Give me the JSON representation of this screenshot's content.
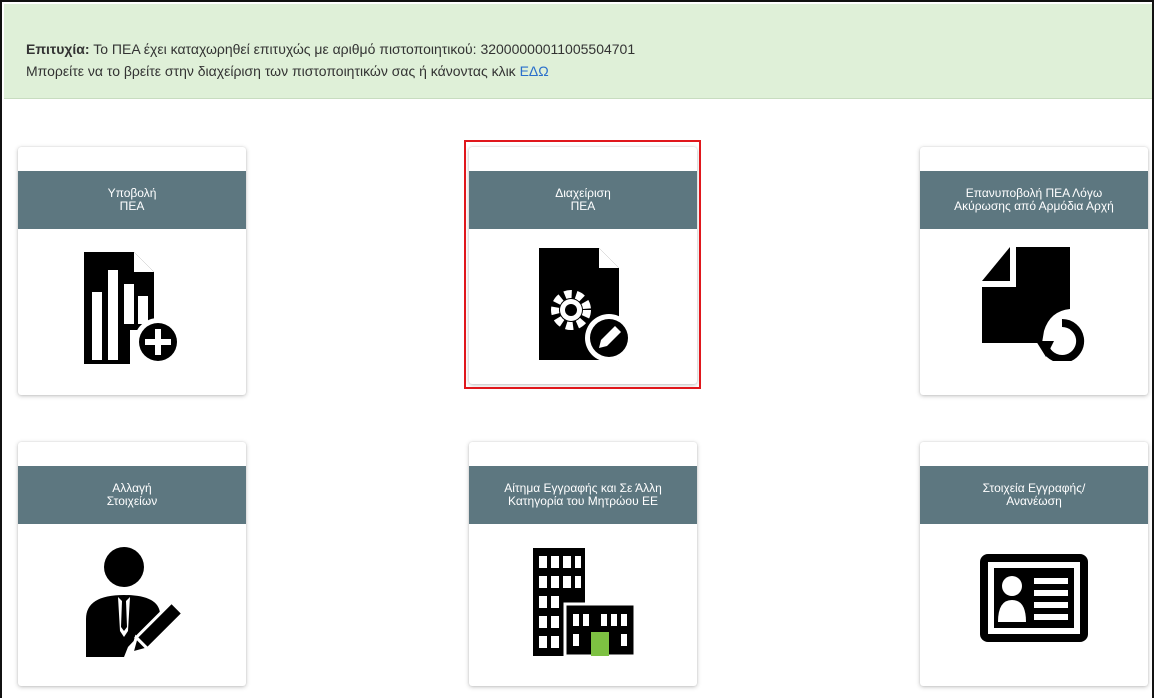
{
  "alert": {
    "label": "Επιτυχία:",
    "message": " Το ΠΕΑ έχει καταχωρηθεί επιτυχώς με αριθμό πιστοποιητικού: 32000000011005504701",
    "line2": "Μπορείτε να το βρείτε στην διαχείριση των πιστοποιητικών σας ή κάνοντας κλικ ",
    "link": "ΕΔΩ",
    "color": "#dff0d8"
  },
  "tiles": [
    {
      "title": "Υποβολή\nΠΕΑ",
      "icon": "document-chart-plus-icon"
    },
    {
      "title": "Διαχείριση\nΠΕΑ",
      "icon": "document-gear-edit-icon",
      "highlighted": true
    },
    {
      "title": "Επανυποβολή ΠΕΑ Λόγω\nΑκύρωσης από Αρμόδια Αρχή",
      "icon": "document-resubmit-icon"
    },
    {
      "title": "Αλλαγή\nΣτοιχείων",
      "icon": "user-edit-icon"
    },
    {
      "title": "Αίτημα Εγγραφής και Σε Άλλη\nΚατηγορία του Μητρώου ΕΕ",
      "icon": "building-icon"
    },
    {
      "title": "Στοιχεία Εγγραφής/\nΑνανέωση",
      "icon": "id-card-icon"
    }
  ],
  "colors": {
    "tile_header": "#5d7780",
    "highlight": "#e0171c",
    "link": "#2a6fcb"
  }
}
